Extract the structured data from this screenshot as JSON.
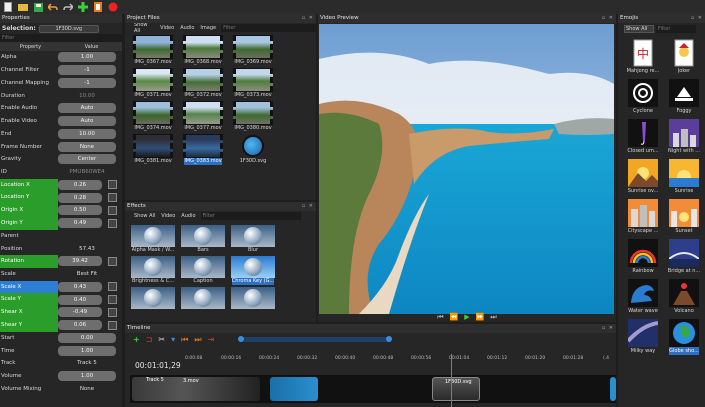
{
  "toolbar": {
    "icons": [
      "new-file-icon",
      "open-folder-icon",
      "save-icon",
      "undo-icon",
      "redo-icon",
      "add-icon",
      "export-film-icon",
      "record-icon"
    ]
  },
  "properties": {
    "title": "Properties",
    "selection_label": "Selection:",
    "selection_value": "1F30D.svg",
    "filter_placeholder": "Filter",
    "col_property": "Property",
    "col_value": "Value",
    "rows": [
      {
        "name": "Alpha",
        "value": "1.00"
      },
      {
        "name": "Channel Filter",
        "value": "-1"
      },
      {
        "name": "Channel Mapping",
        "value": "-1"
      },
      {
        "name": "Duration",
        "value": "10.00"
      },
      {
        "name": "Enable Audio",
        "value": "Auto"
      },
      {
        "name": "Enable Video",
        "value": "Auto"
      },
      {
        "name": "End",
        "value": "10.00"
      },
      {
        "name": "Frame Number",
        "value": "None"
      },
      {
        "name": "Gravity",
        "value": "Center"
      },
      {
        "name": "ID",
        "value": "PMUB60WE4"
      },
      {
        "name": "Location X",
        "value": "0.26"
      },
      {
        "name": "Location Y",
        "value": "0.28"
      },
      {
        "name": "Origin X",
        "value": "0.50"
      },
      {
        "name": "Origin Y",
        "value": "0.49"
      },
      {
        "name": "Parent",
        "value": ""
      },
      {
        "name": "Position",
        "value": "57.43"
      },
      {
        "name": "Rotation",
        "value": "39.42"
      },
      {
        "name": "Scale",
        "value": "Best Fit"
      },
      {
        "name": "Scale X",
        "value": "0.43"
      },
      {
        "name": "Scale Y",
        "value": "0.40"
      },
      {
        "name": "Shear X",
        "value": "-0.49"
      },
      {
        "name": "Shear Y",
        "value": "0.06"
      },
      {
        "name": "Start",
        "value": "0.00"
      },
      {
        "name": "Time",
        "value": "1.00"
      },
      {
        "name": "Track",
        "value": "Track 5"
      },
      {
        "name": "Volume",
        "value": "1.00"
      },
      {
        "name": "Volume Mixing",
        "value": "None"
      }
    ]
  },
  "project_files": {
    "title": "Project Files",
    "tabs": [
      "Show All",
      "Video",
      "Audio",
      "Image"
    ],
    "filter_placeholder": "Filter",
    "items": [
      "IMG_0367.mov",
      "IMG_0368.mov",
      "IMG_0369.mov",
      "IMG_0371.mov",
      "IMG_0372.mov",
      "IMG_0373.mov",
      "IMG_0374.mov",
      "IMG_0377.mov",
      "IMG_0380.mov",
      "IMG_0381.mov",
      "IMG_0383.mov",
      "1F30D.svg"
    ]
  },
  "effects": {
    "title": "Effects",
    "tabs": [
      "Show All",
      "Video",
      "Audio"
    ],
    "filter_placeholder": "Filter",
    "items": [
      "Alpha Mask / W...",
      "Bars",
      "Blur",
      "Brightness & C...",
      "Caption",
      "Chroma Key (G..."
    ]
  },
  "preview": {
    "title": "Video Preview"
  },
  "emojis": {
    "title": "Emojis",
    "dropdown": "Show All",
    "filter_placeholder": "Filter",
    "items": [
      "Mahjong re...",
      "Joker",
      "Cyclone",
      "Foggy",
      "Closed um...",
      "Night with ...",
      "Sunrise ov...",
      "Sunrise",
      "Cityscape ...",
      "Sunset",
      "Rainbow",
      "Bridge at n...",
      "Water wave",
      "Volcano",
      "Milky way",
      "Globe sho..."
    ]
  },
  "timeline": {
    "title": "Timeline",
    "timecode": "00:01:01,29",
    "ruler": [
      "0:00:08",
      "00:00:16",
      "00:00:24",
      "00:00:32",
      "00:00:40",
      "00:00:48",
      "00:00:56",
      "00:01:04",
      "00:01:12",
      "00:01:20",
      "00:01:28",
      "(.4"
    ],
    "track_label": "Track 5",
    "clips": [
      "3.mov",
      "1F30D.svg"
    ]
  },
  "colors": {
    "green": "#2a9d2a",
    "blue": "#2d7fd6",
    "accent": "#3b8de0"
  }
}
